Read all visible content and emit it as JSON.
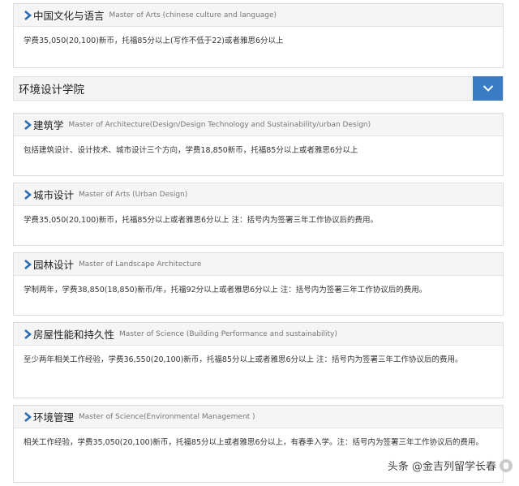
{
  "top_card": {
    "title_cn": "中国文化与语言",
    "title_en": "Master of Arts (chinese culture and language)",
    "body": "学费35,050(20,100)新币，托福85分以上(写作不低于22)或者雅思6分以上"
  },
  "section": {
    "title": "环境设计学院",
    "toggle_icon": "chevron-down-icon"
  },
  "programs": [
    {
      "title_cn": "建筑学",
      "title_en": "Master of Architecture(Design/Design Technology and Sustainability/urban Design)",
      "body": "包括建筑设计、设计技术、城市设计三个方向，学费18,850新币，托福85分以上或者雅思6分以上"
    },
    {
      "title_cn": "城市设计",
      "title_en": "Master of Arts (Urban Design)",
      "body": "学费35,050(20,100)新币，托福85分以上或者雅思6分以上 注：括号内为签署三年工作协议后的费用。"
    },
    {
      "title_cn": "园林设计",
      "title_en": "Master of Landscape Architecture",
      "body": "学制两年，学费38,850(18,850)新币/年，托福92分以上或者雅思6分以上 注：括号内为签署三年工作协议后的费用。"
    },
    {
      "title_cn": "房屋性能和持久性",
      "title_en": "Master of Science (Building Performance and sustainability)",
      "body": "至少两年相关工作经验，学费36,550(20,100)新币，托福85分以上或者雅思6分以上 注：括号内为签署三年工作协议后的费用。"
    },
    {
      "title_cn": "环境管理",
      "title_en": "Master of Science(Environmental Management )",
      "body": "相关工作经验，学费35,050(20,100)新币，托福85分以上或者雅思6分以上，有春季入学。注：括号内为签署三年工作协议后的费用。"
    }
  ],
  "watermark": {
    "text": "头条 @金吉列留学长春"
  },
  "colors": {
    "accent": "#3a7cc4",
    "chevron": "#2b6cb0"
  }
}
